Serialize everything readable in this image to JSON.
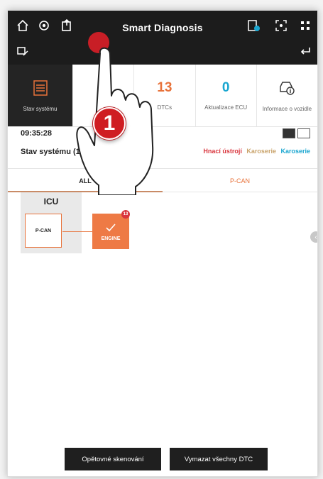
{
  "header": {
    "title": "Smart Diagnosis",
    "icons": [
      "home-icon",
      "settings-icon",
      "upload-icon",
      "report-icon",
      "screenshot-icon",
      "grid-icon",
      "vehicle-edit-icon",
      "return-icon"
    ]
  },
  "tiles": [
    {
      "label": "Stav systému",
      "icon": "checklist-icon",
      "active": true
    },
    {
      "label": "",
      "hidden_by_overlay": true
    },
    {
      "value": "13",
      "label": "DTCs"
    },
    {
      "value": "0",
      "label": "Aktualizace ECU"
    },
    {
      "label": "Informace o vozidle",
      "icon": "vehicle-info-icon"
    }
  ],
  "status": {
    "time": "09:35:28",
    "title": "Stav systému (1/1)",
    "legend": [
      {
        "label": "Hnací ústrojí",
        "color": "#d9363e"
      },
      {
        "label": "Karoserie",
        "color": "#c9a36b"
      },
      {
        "label": "Karoserie",
        "color": "#1aa6d0"
      }
    ]
  },
  "tabs": [
    {
      "label": "ALL",
      "active": true
    },
    {
      "label": "P-CAN",
      "active": false
    }
  ],
  "topology": {
    "group": "ICU",
    "bus_node": "P-CAN",
    "ecu": {
      "label": "ENGINE",
      "dtc_count": "13"
    }
  },
  "buttons": {
    "rescan": "Opětovné skenování",
    "clear": "Vymazat všechny DTC"
  },
  "overlay": {
    "step": "1"
  },
  "colors": {
    "accent": "#e8723a",
    "blue": "#1aa6d0",
    "dark": "#1c1c1c",
    "danger": "#d9363e"
  }
}
